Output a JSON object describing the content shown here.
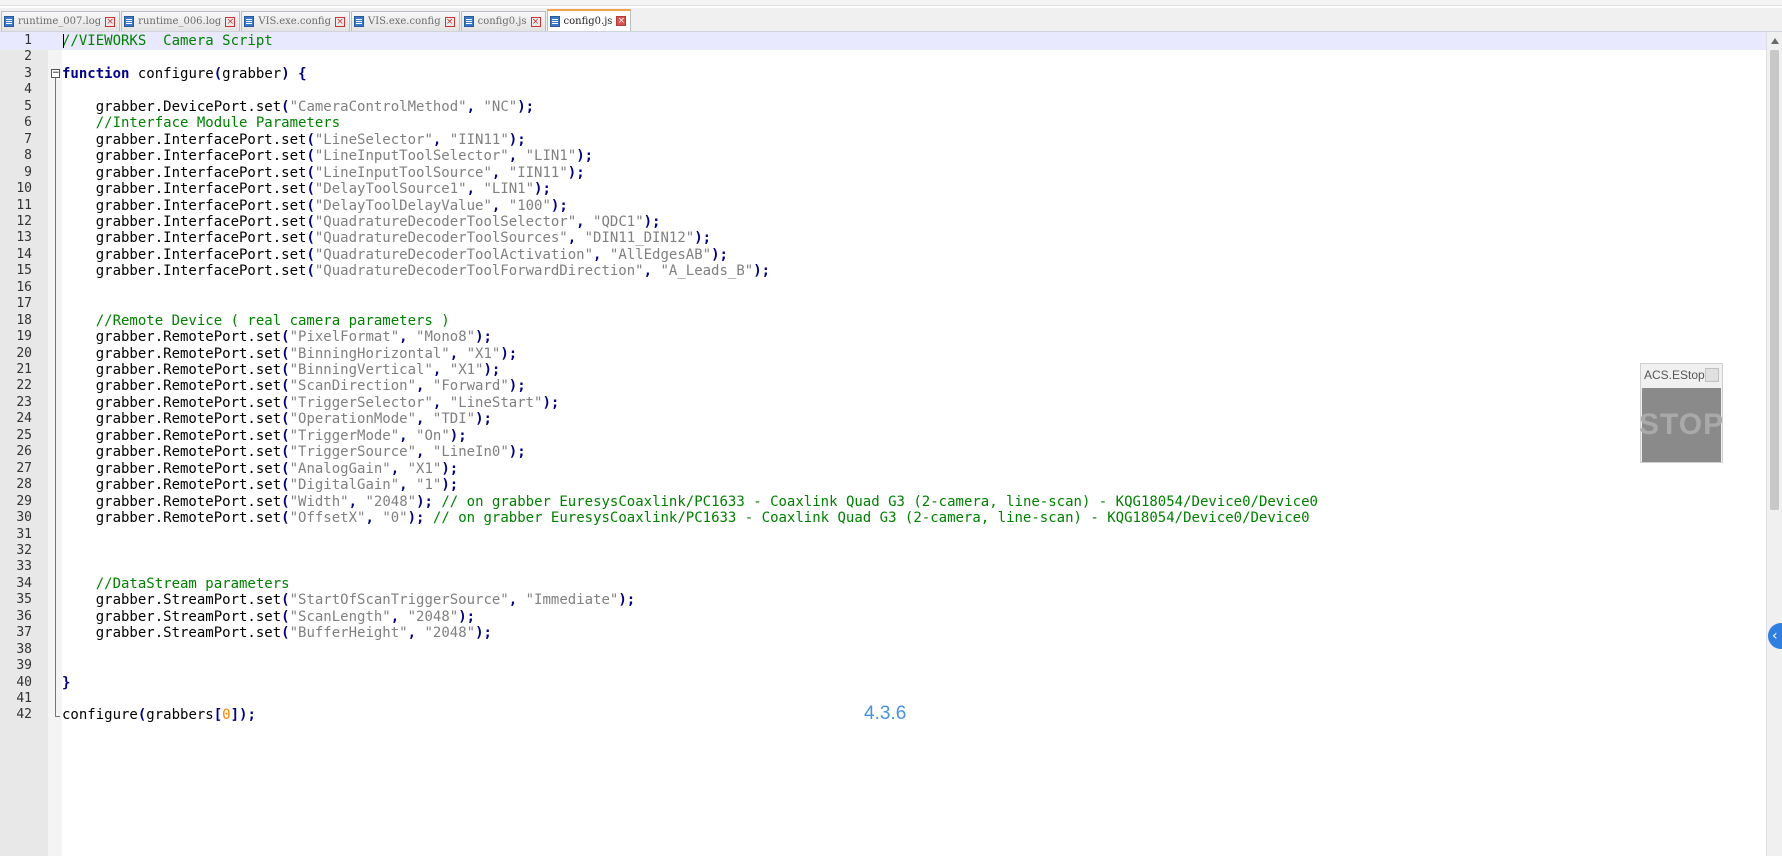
{
  "tabs": [
    {
      "label": "runtime_007.log",
      "active": false
    },
    {
      "label": "runtime_006.log",
      "active": false
    },
    {
      "label": "VIS.exe.config",
      "active": false
    },
    {
      "label": "VIS.exe.config",
      "active": false
    },
    {
      "label": "config0.js",
      "active": false
    },
    {
      "label": "config0.js",
      "active": true
    }
  ],
  "editor": {
    "lines": [
      [
        [
          "cm",
          "//VIEWORKS  Camera Script"
        ]
      ],
      [],
      [
        [
          "kw",
          "function"
        ],
        [
          "id",
          " configure"
        ],
        [
          "op",
          "("
        ],
        [
          "id",
          "grabber"
        ],
        [
          "op",
          ")"
        ],
        [
          "id",
          " "
        ],
        [
          "op",
          "{"
        ]
      ],
      [],
      [
        [
          "id",
          "    grabber.DevicePort.set"
        ],
        [
          "op",
          "("
        ],
        [
          "st",
          "\"CameraControlMethod\""
        ],
        [
          "op",
          ","
        ],
        [
          "id",
          " "
        ],
        [
          "st",
          "\"NC\""
        ],
        [
          "op",
          ");"
        ]
      ],
      [
        [
          "cm",
          "    //Interface Module Parameters"
        ]
      ],
      [
        [
          "id",
          "    grabber.InterfacePort.set"
        ],
        [
          "op",
          "("
        ],
        [
          "st",
          "\"LineSelector\""
        ],
        [
          "op",
          ","
        ],
        [
          "id",
          " "
        ],
        [
          "st",
          "\"IIN11\""
        ],
        [
          "op",
          ");"
        ]
      ],
      [
        [
          "id",
          "    grabber.InterfacePort.set"
        ],
        [
          "op",
          "("
        ],
        [
          "st",
          "\"LineInputToolSelector\""
        ],
        [
          "op",
          ","
        ],
        [
          "id",
          " "
        ],
        [
          "st",
          "\"LIN1\""
        ],
        [
          "op",
          ");"
        ]
      ],
      [
        [
          "id",
          "    grabber.InterfacePort.set"
        ],
        [
          "op",
          "("
        ],
        [
          "st",
          "\"LineInputToolSource\""
        ],
        [
          "op",
          ","
        ],
        [
          "id",
          " "
        ],
        [
          "st",
          "\"IIN11\""
        ],
        [
          "op",
          ");"
        ]
      ],
      [
        [
          "id",
          "    grabber.InterfacePort.set"
        ],
        [
          "op",
          "("
        ],
        [
          "st",
          "\"DelayToolSource1\""
        ],
        [
          "op",
          ","
        ],
        [
          "id",
          " "
        ],
        [
          "st",
          "\"LIN1\""
        ],
        [
          "op",
          ");"
        ]
      ],
      [
        [
          "id",
          "    grabber.InterfacePort.set"
        ],
        [
          "op",
          "("
        ],
        [
          "st",
          "\"DelayToolDelayValue\""
        ],
        [
          "op",
          ","
        ],
        [
          "id",
          " "
        ],
        [
          "st",
          "\"100\""
        ],
        [
          "op",
          ");"
        ]
      ],
      [
        [
          "id",
          "    grabber.InterfacePort.set"
        ],
        [
          "op",
          "("
        ],
        [
          "st",
          "\"QuadratureDecoderToolSelector\""
        ],
        [
          "op",
          ","
        ],
        [
          "id",
          " "
        ],
        [
          "st",
          "\"QDC1\""
        ],
        [
          "op",
          ");"
        ]
      ],
      [
        [
          "id",
          "    grabber.InterfacePort.set"
        ],
        [
          "op",
          "("
        ],
        [
          "st",
          "\"QuadratureDecoderToolSources\""
        ],
        [
          "op",
          ","
        ],
        [
          "id",
          " "
        ],
        [
          "st",
          "\"DIN11_DIN12\""
        ],
        [
          "op",
          ");"
        ]
      ],
      [
        [
          "id",
          "    grabber.InterfacePort.set"
        ],
        [
          "op",
          "("
        ],
        [
          "st",
          "\"QuadratureDecoderToolActivation\""
        ],
        [
          "op",
          ","
        ],
        [
          "id",
          " "
        ],
        [
          "st",
          "\"AllEdgesAB\""
        ],
        [
          "op",
          ");"
        ]
      ],
      [
        [
          "id",
          "    grabber.InterfacePort.set"
        ],
        [
          "op",
          "("
        ],
        [
          "st",
          "\"QuadratureDecoderToolForwardDirection\""
        ],
        [
          "op",
          ","
        ],
        [
          "id",
          " "
        ],
        [
          "st",
          "\"A_Leads_B\""
        ],
        [
          "op",
          ");"
        ]
      ],
      [],
      [],
      [
        [
          "cm",
          "    //Remote Device ( real camera parameters )"
        ]
      ],
      [
        [
          "id",
          "    grabber.RemotePort.set"
        ],
        [
          "op",
          "("
        ],
        [
          "st",
          "\"PixelFormat\""
        ],
        [
          "op",
          ","
        ],
        [
          "id",
          " "
        ],
        [
          "st",
          "\"Mono8\""
        ],
        [
          "op",
          ");"
        ]
      ],
      [
        [
          "id",
          "    grabber.RemotePort.set"
        ],
        [
          "op",
          "("
        ],
        [
          "st",
          "\"BinningHorizontal\""
        ],
        [
          "op",
          ","
        ],
        [
          "id",
          " "
        ],
        [
          "st",
          "\"X1\""
        ],
        [
          "op",
          ");"
        ]
      ],
      [
        [
          "id",
          "    grabber.RemotePort.set"
        ],
        [
          "op",
          "("
        ],
        [
          "st",
          "\"BinningVertical\""
        ],
        [
          "op",
          ","
        ],
        [
          "id",
          " "
        ],
        [
          "st",
          "\"X1\""
        ],
        [
          "op",
          ");"
        ]
      ],
      [
        [
          "id",
          "    grabber.RemotePort.set"
        ],
        [
          "op",
          "("
        ],
        [
          "st",
          "\"ScanDirection\""
        ],
        [
          "op",
          ","
        ],
        [
          "id",
          " "
        ],
        [
          "st",
          "\"Forward\""
        ],
        [
          "op",
          ");"
        ]
      ],
      [
        [
          "id",
          "    grabber.RemotePort.set"
        ],
        [
          "op",
          "("
        ],
        [
          "st",
          "\"TriggerSelector\""
        ],
        [
          "op",
          ","
        ],
        [
          "id",
          " "
        ],
        [
          "st",
          "\"LineStart\""
        ],
        [
          "op",
          ");"
        ]
      ],
      [
        [
          "id",
          "    grabber.RemotePort.set"
        ],
        [
          "op",
          "("
        ],
        [
          "st",
          "\"OperationMode\""
        ],
        [
          "op",
          ","
        ],
        [
          "id",
          " "
        ],
        [
          "st",
          "\"TDI\""
        ],
        [
          "op",
          ");"
        ]
      ],
      [
        [
          "id",
          "    grabber.RemotePort.set"
        ],
        [
          "op",
          "("
        ],
        [
          "st",
          "\"TriggerMode\""
        ],
        [
          "op",
          ","
        ],
        [
          "id",
          " "
        ],
        [
          "st",
          "\"On\""
        ],
        [
          "op",
          ");"
        ]
      ],
      [
        [
          "id",
          "    grabber.RemotePort.set"
        ],
        [
          "op",
          "("
        ],
        [
          "st",
          "\"TriggerSource\""
        ],
        [
          "op",
          ","
        ],
        [
          "id",
          " "
        ],
        [
          "st",
          "\"LineIn0\""
        ],
        [
          "op",
          ");"
        ]
      ],
      [
        [
          "id",
          "    grabber.RemotePort.set"
        ],
        [
          "op",
          "("
        ],
        [
          "st",
          "\"AnalogGain\""
        ],
        [
          "op",
          ","
        ],
        [
          "id",
          " "
        ],
        [
          "st",
          "\"X1\""
        ],
        [
          "op",
          ");"
        ]
      ],
      [
        [
          "id",
          "    grabber.RemotePort.set"
        ],
        [
          "op",
          "("
        ],
        [
          "st",
          "\"DigitalGain\""
        ],
        [
          "op",
          ","
        ],
        [
          "id",
          " "
        ],
        [
          "st",
          "\"1\""
        ],
        [
          "op",
          ");"
        ]
      ],
      [
        [
          "id",
          "    grabber.RemotePort.set"
        ],
        [
          "op",
          "("
        ],
        [
          "st",
          "\"Width\""
        ],
        [
          "op",
          ","
        ],
        [
          "id",
          " "
        ],
        [
          "st",
          "\"2048\""
        ],
        [
          "op",
          ");"
        ],
        [
          "id",
          " "
        ],
        [
          "cm",
          "// on grabber EuresysCoaxlink/PC1633 - Coaxlink Quad G3 (2-camera, line-scan) - KQG18054/Device0/Device0"
        ]
      ],
      [
        [
          "id",
          "    grabber.RemotePort.set"
        ],
        [
          "op",
          "("
        ],
        [
          "st",
          "\"OffsetX\""
        ],
        [
          "op",
          ","
        ],
        [
          "id",
          " "
        ],
        [
          "st",
          "\"0\""
        ],
        [
          "op",
          ");"
        ],
        [
          "id",
          " "
        ],
        [
          "cm",
          "// on grabber EuresysCoaxlink/PC1633 - Coaxlink Quad G3 (2-camera, line-scan) - KQG18054/Device0/Device0"
        ]
      ],
      [],
      [],
      [],
      [
        [
          "cm",
          "    //DataStream parameters"
        ]
      ],
      [
        [
          "id",
          "    grabber.StreamPort.set"
        ],
        [
          "op",
          "("
        ],
        [
          "st",
          "\"StartOfScanTriggerSource\""
        ],
        [
          "op",
          ","
        ],
        [
          "id",
          " "
        ],
        [
          "st",
          "\"Immediate\""
        ],
        [
          "op",
          ");"
        ]
      ],
      [
        [
          "id",
          "    grabber.StreamPort.set"
        ],
        [
          "op",
          "("
        ],
        [
          "st",
          "\"ScanLength\""
        ],
        [
          "op",
          ","
        ],
        [
          "id",
          " "
        ],
        [
          "st",
          "\"2048\""
        ],
        [
          "op",
          ");"
        ]
      ],
      [
        [
          "id",
          "    grabber.StreamPort.set"
        ],
        [
          "op",
          "("
        ],
        [
          "st",
          "\"BufferHeight\""
        ],
        [
          "op",
          ","
        ],
        [
          "id",
          " "
        ],
        [
          "st",
          "\"2048\""
        ],
        [
          "op",
          ");"
        ]
      ],
      [],
      [],
      [
        [
          "op",
          "}"
        ]
      ],
      [],
      [
        [
          "id",
          "configure"
        ],
        [
          "op",
          "("
        ],
        [
          "id",
          "grabbers"
        ],
        [
          "op",
          "["
        ],
        [
          "nm",
          "0"
        ],
        [
          "op",
          "]);"
        ]
      ]
    ]
  },
  "overlay": {
    "estop_title": "ACS.EStop",
    "stop_label": "STOP",
    "version": "4.3.6"
  },
  "colors": {
    "keyword": "#00008b",
    "comment": "#008000",
    "string": "#808080",
    "operator": "#000080",
    "number": "#ff8000",
    "current_line": "#e8e8ff",
    "active_tab_accent": "#f3a04f"
  }
}
